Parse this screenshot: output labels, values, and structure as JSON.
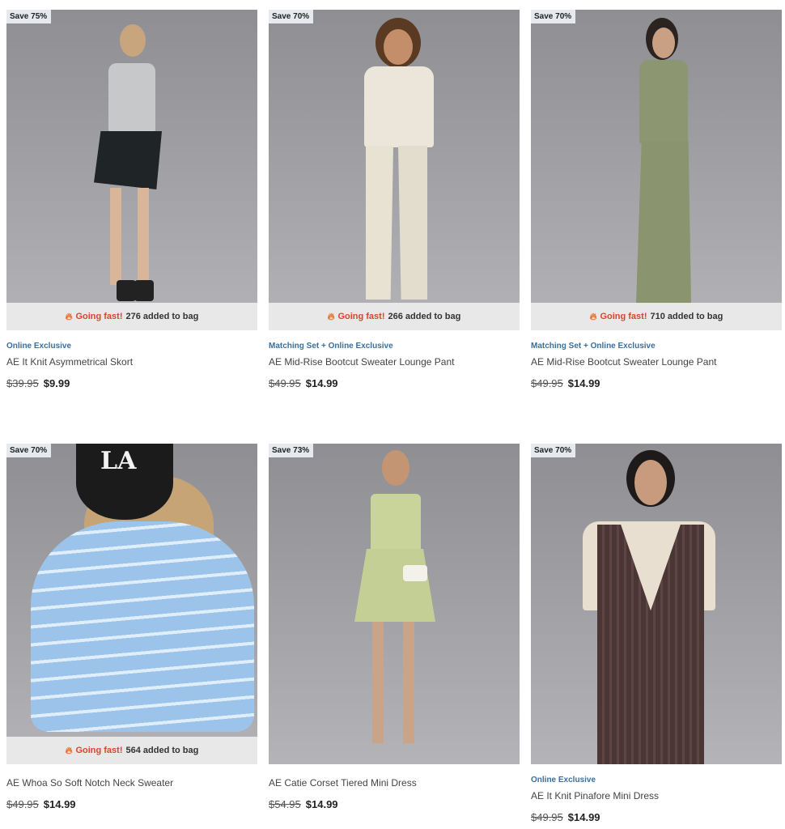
{
  "products": [
    {
      "badge": "Save 75%",
      "fast_label": "Going fast!",
      "fast_count": "276 added to bag",
      "tag": "Online Exclusive",
      "name": "AE It Knit Asymmetrical Skort",
      "was": "$39.95",
      "now": "$9.99"
    },
    {
      "badge": "Save 70%",
      "fast_label": "Going fast!",
      "fast_count": "266 added to bag",
      "tag": "Matching Set + Online Exclusive",
      "name": "AE Mid-Rise Bootcut Sweater Lounge Pant",
      "was": "$49.95",
      "now": "$14.99"
    },
    {
      "badge": "Save 70%",
      "fast_label": "Going fast!",
      "fast_count": "710 added to bag",
      "tag": "Matching Set + Online Exclusive",
      "name": "AE Mid-Rise Bootcut Sweater Lounge Pant",
      "was": "$49.95",
      "now": "$14.99"
    },
    {
      "badge": "Save 70%",
      "fast_label": "Going fast!",
      "fast_count": "564 added to bag",
      "tag": "",
      "name": "AE Whoa So Soft Notch Neck Sweater",
      "was": "$49.95",
      "now": "$14.99"
    },
    {
      "badge": "Save 73%",
      "fast_label": "",
      "fast_count": "",
      "tag": "",
      "name": "AE Catie Corset Tiered Mini Dress",
      "was": "$54.95",
      "now": "$14.99"
    },
    {
      "badge": "Save 70%",
      "fast_label": "",
      "fast_count": "",
      "tag": "Online Exclusive",
      "name": "AE It Knit Pinafore Mini Dress",
      "was": "$49.95",
      "now": "$14.99"
    }
  ],
  "cap_text": "LA",
  "colors": {
    "tag": "#3a6f9e",
    "going_fast": "#d9442f",
    "flame": "#e8752a"
  }
}
